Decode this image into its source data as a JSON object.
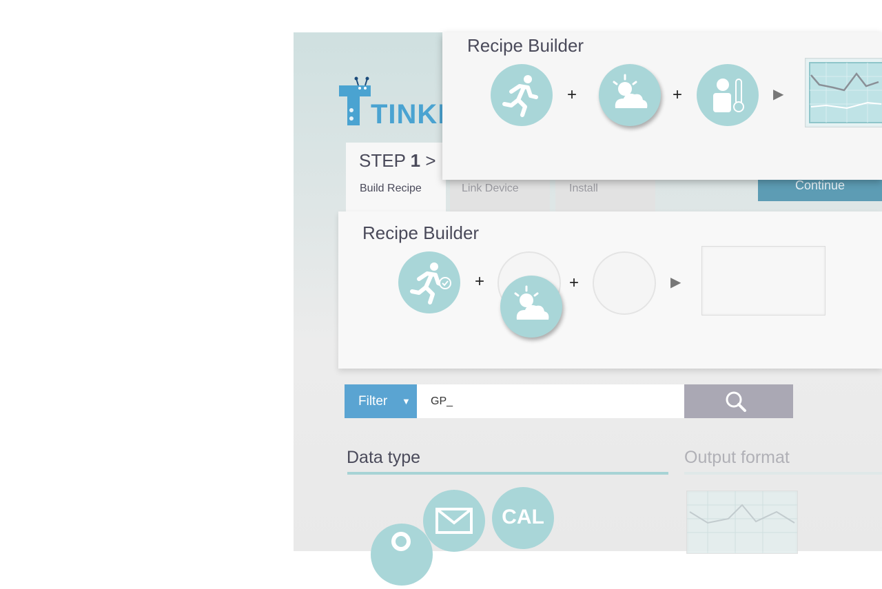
{
  "brand": {
    "logo_text": "TINKE"
  },
  "steps": {
    "active": {
      "step_label": "STEP",
      "step_number": "1",
      "chevron": ">",
      "name": "Build Recipe"
    },
    "tab2": {
      "name": "Link Device"
    },
    "tab3": {
      "name": "Install"
    },
    "continue_label": "Continue"
  },
  "builder": {
    "title": "Recipe Builder",
    "plus": "+",
    "slots": [
      "running-person-icon",
      "sun-cloud-icon",
      "empty",
      "empty"
    ],
    "dragging": "sun-cloud-icon"
  },
  "builder_front": {
    "title": "Recipe Builder",
    "plus": "+",
    "slots": [
      "running-person-icon",
      "sun-cloud-icon",
      "person-thermometer-icon",
      "line-chart-icon"
    ]
  },
  "search": {
    "filter_label": "Filter",
    "filter_arrow": "▼",
    "query": "GP_"
  },
  "sections": {
    "data_type": "Data type",
    "output_format": "Output format",
    "data_type_items": [
      {
        "icon": "location-pin-icon"
      },
      {
        "icon": "mail-icon"
      },
      {
        "icon": "cal-icon",
        "label": "CAL"
      }
    ]
  },
  "colors": {
    "teal": "#a9d6d8",
    "blue": "#5aa4d2",
    "continue": "#5d9cb4",
    "search_button": "#aaa8b4"
  }
}
